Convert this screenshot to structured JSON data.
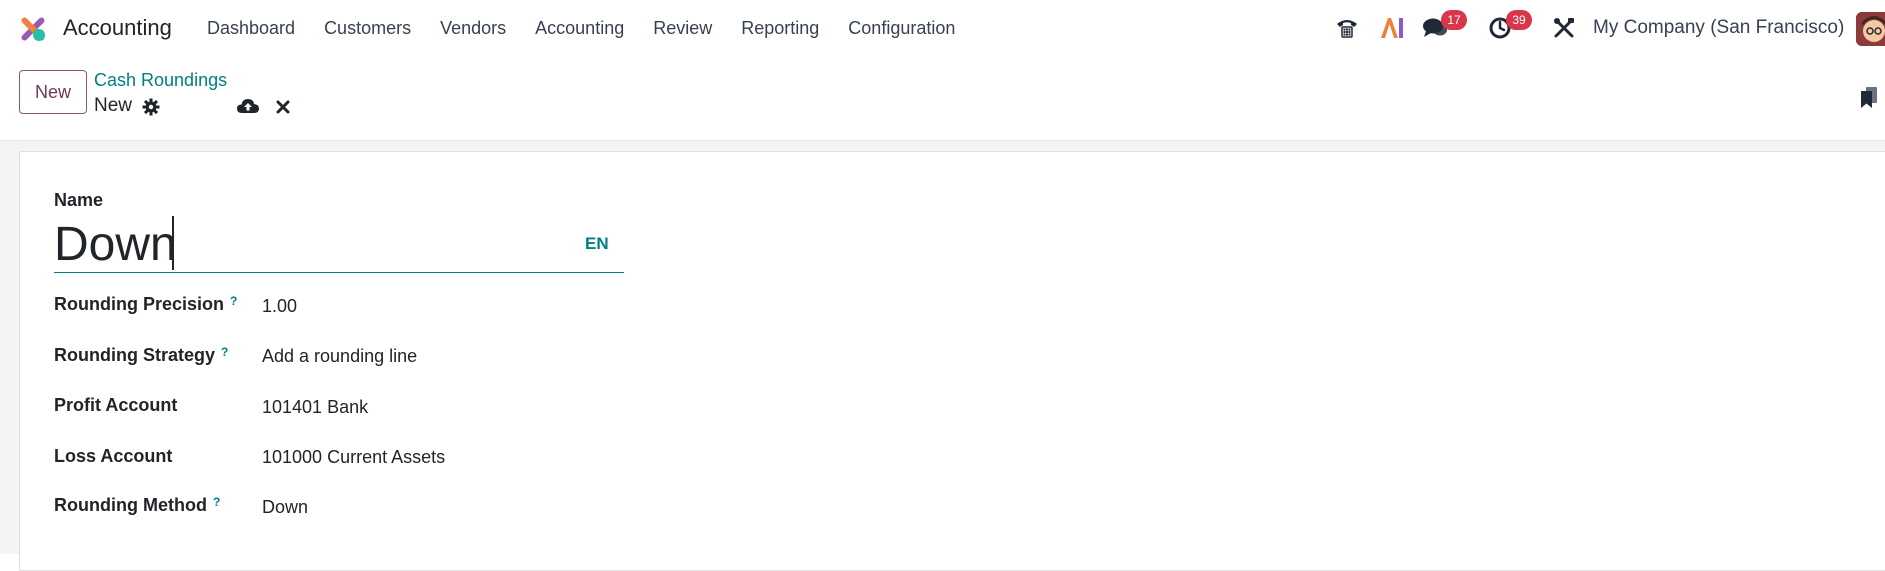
{
  "app": {
    "name": "Accounting",
    "logo_colors": {
      "primary": "#d74f55",
      "secondary": "#25c1a4",
      "tertiary": "#9b59b6"
    }
  },
  "nav": {
    "items": [
      {
        "label": "Dashboard"
      },
      {
        "label": "Customers"
      },
      {
        "label": "Vendors"
      },
      {
        "label": "Accounting"
      },
      {
        "label": "Review"
      },
      {
        "label": "Reporting"
      },
      {
        "label": "Configuration"
      }
    ]
  },
  "systray": {
    "phone_icon": "phone-icon",
    "ai_icon": "ai-icon",
    "messages_count": "17",
    "activities_count": "39",
    "debug_icon": "tools-icon",
    "company": "My Company (San Francisco)"
  },
  "control_panel": {
    "new_button": "New",
    "breadcrumb": "Cash Roundings",
    "record_title": "New"
  },
  "form": {
    "name_label": "Name",
    "name_value": "Down",
    "language": "EN",
    "fields": [
      {
        "label": "Rounding Precision",
        "help": "?",
        "value": "1.00"
      },
      {
        "label": "Rounding Strategy",
        "help": "?",
        "value": "Add a rounding line"
      },
      {
        "label": "Profit Account",
        "help": "",
        "value": "101401 Bank"
      },
      {
        "label": "Loss Account",
        "help": "",
        "value": "101000 Current Assets"
      },
      {
        "label": "Rounding Method",
        "help": "?",
        "value": "Down"
      }
    ]
  },
  "colors": {
    "accent": "#017e84",
    "primary_button": "#6f3a58",
    "badge": "#d9364c"
  }
}
